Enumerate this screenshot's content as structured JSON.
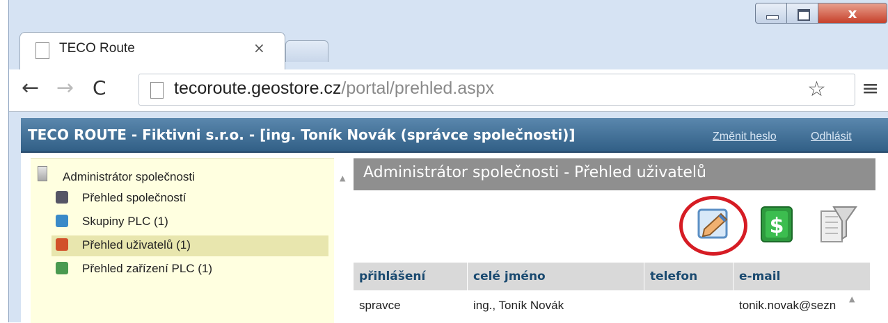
{
  "browser": {
    "tab_title": "TECO Route",
    "tab_close": "×",
    "close_glyph": "x",
    "url_host": "tecoroute.geostore.cz",
    "url_path": "/portal/prehled.aspx",
    "back_glyph": "←",
    "forward_glyph": "→",
    "reload_glyph": "C",
    "star_glyph": "☆",
    "menu_glyph": "≡"
  },
  "header": {
    "title": "TECO ROUTE - Fiktivni s.r.o. - [ing. Toník Novák (správce společnosti)]",
    "change_password": "Změnit heslo",
    "logout": "Odhlásit"
  },
  "sidebar": {
    "root": "Administrátor společnosti",
    "items": [
      {
        "label": "Přehled společností",
        "icon": "companies-icon",
        "color": "#555566"
      },
      {
        "label": "Skupiny PLC (1)",
        "icon": "plc-groups-icon",
        "color": "#3a8ac8"
      },
      {
        "label": "Přehled uživatelů (1)",
        "icon": "users-icon",
        "color": "#d2502a"
      },
      {
        "label": "Přehled zařízení PLC (1)",
        "icon": "plc-devices-icon",
        "color": "#4a9a50"
      }
    ],
    "selected_index": 2,
    "selected_color": "#e8e6ae"
  },
  "main": {
    "title": "Administrátor společnosti - Přehled uživatelů",
    "actions": [
      {
        "name": "edit-icon"
      },
      {
        "name": "billing-icon",
        "glyph": "$"
      },
      {
        "name": "filter-icon"
      }
    ],
    "highlight_color": "#d61c24"
  },
  "table": {
    "columns": [
      "přihlášení",
      "celé jméno",
      "telefon",
      "e-mail"
    ],
    "rows": [
      [
        "spravce",
        "ing., Toník Novák",
        "",
        "tonik.novak@sezn"
      ]
    ]
  },
  "colors": {
    "appbar": "#3d6a92",
    "sidebar_bg": "#ffffe0",
    "header_text": "#1a4a70"
  }
}
